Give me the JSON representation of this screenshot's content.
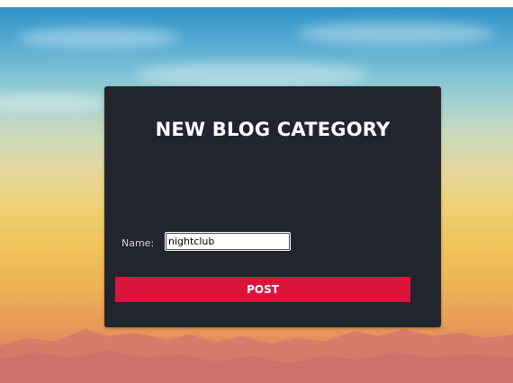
{
  "form": {
    "title": "NEW BLOG CATEGORY",
    "name_label": "Name:",
    "name_value": "nightclub",
    "submit_label": "POST"
  },
  "colors": {
    "card_background": "#22252b",
    "button_background": "#dc143c",
    "title_text": "#ffffff"
  }
}
